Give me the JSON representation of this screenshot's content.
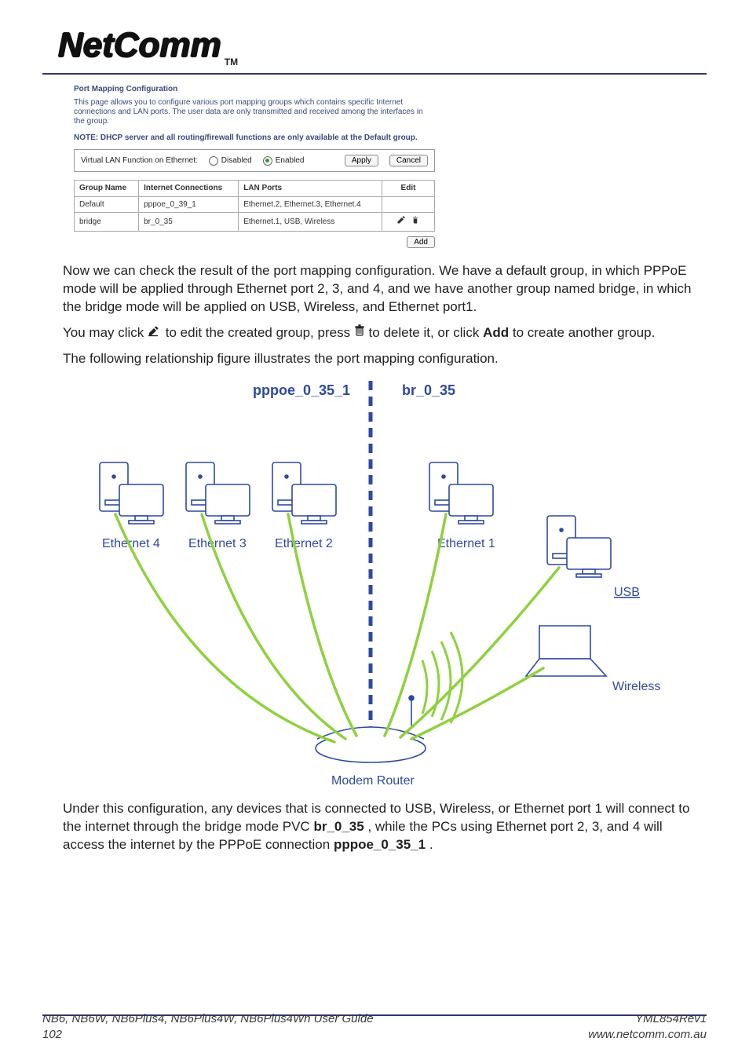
{
  "header": {
    "brand": "NetComm",
    "tm": "TM"
  },
  "panel": {
    "title": "Port Mapping Configuration",
    "desc": "This page allows you to configure various port mapping groups which contains specific Internet connections and LAN ports. The user data are only transmitted and received among the interfaces in the group.",
    "note": "NOTE: DHCP server and all routing/firewall functions are only available at the Default group.",
    "vlan_label": "Virtual LAN Function on Ethernet:",
    "disabled_label": "Disabled",
    "enabled_label": "Enabled",
    "apply_label": "Apply",
    "cancel_label": "Cancel",
    "headers": {
      "group": "Group Name",
      "conn": "Internet Connections",
      "lan": "LAN Ports",
      "edit": "Edit"
    },
    "rows": [
      {
        "group": "Default",
        "conn": "pppoe_0_39_1",
        "lan": "Ethernet.2, Ethernet.3, Ethernet.4",
        "editable": false
      },
      {
        "group": "bridge",
        "conn": "br_0_35",
        "lan": "Ethernet.1, USB, Wireless",
        "editable": true
      }
    ],
    "add_label": "Add"
  },
  "body": {
    "p1": "Now we can check the result of the port mapping configuration. We have a default group, in which PPPoE mode will be applied through Ethernet port 2, 3, and 4, and we have another group named bridge, in which the bridge mode will be applied on USB, Wireless, and Ethernet port1.",
    "p2a": "You may click ",
    "p2b": " to edit the created group, press ",
    "p2c": " to delete it, or click ",
    "p2_add": "Add",
    "p2d": " to create another group.",
    "p3": "The following relationship figure illustrates the port mapping configuration.",
    "p4a": "Under this configuration, any devices that is connected to USB, Wireless, or Ethernet port 1 will connect to the internet through the bridge mode PVC ",
    "p4_b1": "br_0_35",
    "p4b": ", while the PCs using Ethernet port 2, 3, and 4 will access the internet by the PPPoE connection ",
    "p4_b2": "pppoe_0_35_1",
    "p4c": "."
  },
  "diagram": {
    "left_title": "pppoe_0_35_1",
    "right_title": "br_0_35",
    "eth4": "Ethernet 4",
    "eth3": "Ethernet 3",
    "eth2": "Ethernet 2",
    "eth1": "Ethernet 1",
    "usb": "USB",
    "wireless": "Wireless",
    "router": "Modem Router"
  },
  "footer": {
    "left_line1": "NB6, NB6W, NB6Plus4, NB6Plus4W, NB6Plus4Wn User Guide",
    "left_line2": "102",
    "right_line1": "YML854Rev1",
    "right_line2": "www.netcomm.com.au"
  }
}
